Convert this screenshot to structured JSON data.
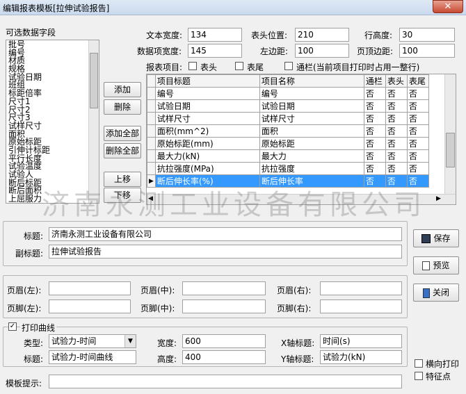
{
  "window": {
    "title": "编辑报表模板[拉伸试验报告]",
    "close": "✕"
  },
  "fields_panel": {
    "label": "可选数据字段",
    "items": [
      "批号",
      "编号",
      "材质",
      "规格",
      "试验日期",
      "班组",
      "标距倍率",
      "尺寸1",
      "尺寸2",
      "尺寸3",
      "试样尺寸",
      "面积",
      "原始标距",
      "引伸计标距",
      "平行长度",
      "试验温度",
      "试验人",
      "断后标距",
      "断后面积",
      "上屈服力"
    ]
  },
  "buttons": {
    "add": "添加",
    "delete": "删除",
    "add_all": "添加全部",
    "delete_all": "删除全部",
    "move_up": "上移",
    "move_down": "下移",
    "save": "保存",
    "preview": "预览",
    "close": "关闭"
  },
  "layout_fields": {
    "text_width_label": "文本宽度:",
    "text_width": "134",
    "header_pos_label": "表头位置:",
    "header_pos": "210",
    "row_height_label": "行高度:",
    "row_height": "30",
    "data_width_label": "数据项宽度:",
    "data_width": "145",
    "left_margin_label": "左边距:",
    "left_margin": "100",
    "top_margin_label": "页顶边距:",
    "top_margin": "100"
  },
  "report_items": {
    "label": "报表项目:",
    "header_cb": "表头",
    "footer_cb": "表尾",
    "column_cb": "通栏(当前项目打印时占用一整行)"
  },
  "grid": {
    "headers": [
      "项目标题",
      "项目名称",
      "通栏",
      "表头",
      "表尾"
    ],
    "rows": [
      [
        "编号",
        "编号",
        "否",
        "否",
        "否"
      ],
      [
        "试验日期",
        "试验日期",
        "否",
        "否",
        "否"
      ],
      [
        "试样尺寸",
        "试样尺寸",
        "否",
        "否",
        "否"
      ],
      [
        "面积(mm^2)",
        "面积",
        "否",
        "否",
        "否"
      ],
      [
        "原始标距(mm)",
        "原始标距",
        "否",
        "否",
        "否"
      ],
      [
        "最大力(kN)",
        "最大力",
        "否",
        "否",
        "否"
      ],
      [
        "抗拉强度(MPa)",
        "抗拉强度",
        "否",
        "否",
        "否"
      ],
      [
        "断后伸长率(%)",
        "断后伸长率",
        "否",
        "否",
        "否"
      ]
    ],
    "selected_marker": "▶"
  },
  "watermark": "济南永测工业设备有限公司",
  "title_section": {
    "title_label": "标题:",
    "title_value": "济南永测工业设备有限公司",
    "subtitle_label": "副标题:",
    "subtitle_value": "拉伸试验报告"
  },
  "header_footer": {
    "header_left": "页眉(左):",
    "header_mid": "页眉(中):",
    "header_right": "页眉(右):",
    "footer_left": "页脚(左):",
    "footer_mid": "页脚(中):",
    "footer_right": "页脚(右):"
  },
  "curve": {
    "print_cb": "打印曲线",
    "type_label": "类型:",
    "type_value": "试验力-时间",
    "width_label": "宽度:",
    "width_value": "600",
    "xaxis_label": "X轴标题:",
    "xaxis_value": "时间(s)",
    "title_label": "标题:",
    "title_value": "试验力-时间曲线",
    "height_label": "高度:",
    "height_value": "400",
    "yaxis_label": "Y轴标题:",
    "yaxis_value": "试验力(kN)"
  },
  "options": {
    "landscape": "横向打印",
    "feature_point": "特征点"
  },
  "template_hint_label": "模板提示:",
  "colors": {
    "selection": "#3399ff",
    "accent": "#2a5fa8"
  }
}
